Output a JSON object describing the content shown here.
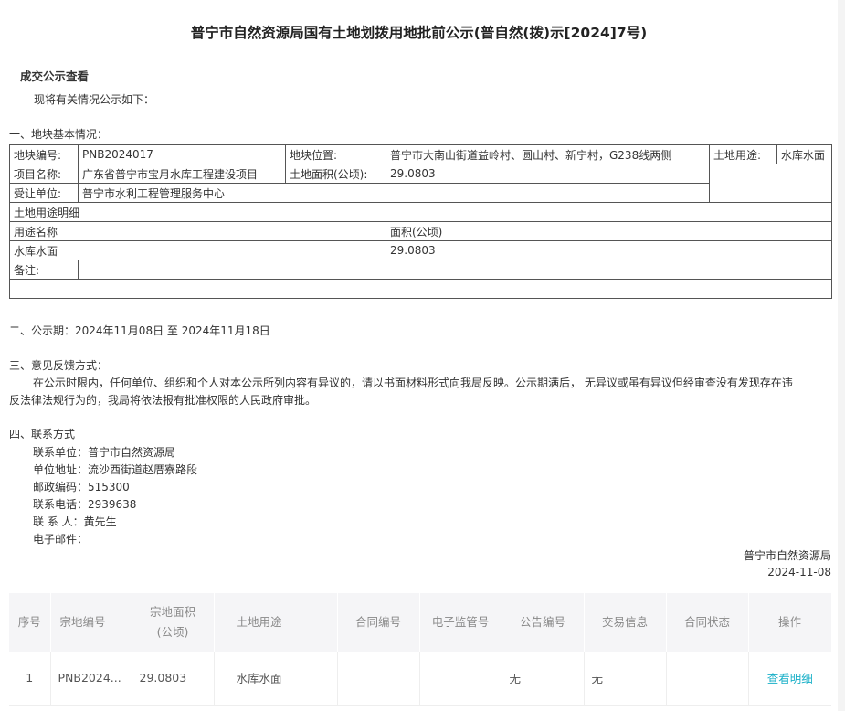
{
  "title": "普宁市自然资源局国有土地划拨用地批前公示(普自然(拨)示[2024]7号)",
  "section_heading": "成交公示查看",
  "intro": "现将有关情况公示如下：",
  "section1_title": "一、地块基本情况：",
  "table": {
    "plot_no_label": "地块编号:",
    "plot_no": "PNB2024017",
    "location_label": "地块位置:",
    "location": "普宁市大南山街道益岭村、圆山村、新宁村，G238线两侧",
    "usage_label": "土地用途:",
    "usage": "水库水面",
    "project_label": "项目名称:",
    "project": "广东省普宁市宝月水库工程建设项目",
    "area_label": "土地面积(公顷):",
    "area": "29.0803",
    "grantee_label": "受让单位:",
    "grantee": "普宁市水利工程管理服务中心",
    "usage_detail_label": "土地用途明细",
    "usage_name_header": "用途名称",
    "area_header": "面积(公顷)",
    "usage_row_name": "水库水面",
    "usage_row_area": "29.0803",
    "remark_label": "备注:",
    "remark": ""
  },
  "section2": "二、公示期：2024年11月08日 至 2024年11月18日",
  "section3_title": "三、意见反馈方式：",
  "section3_line1": "在公示时限内，任何单位、组织和个人对本公示所列内容有异议的，请以书面材料形式向我局反映。公示期满后， 无异议或虽有异议但经审查没有发现存在违",
  "section3_line2": "反法律法规行为的，我局将依法报有批准权限的人民政府审批。",
  "section4_title": "四、联系方式",
  "contact": {
    "unit": "联系单位：普宁市自然资源局",
    "address": "单位地址：流沙西街道赵厝寮路段",
    "postcode": "邮政编码：515300",
    "phone": "联系电话：2939638",
    "person": "联 系 人：黄先生",
    "email": "电子邮件："
  },
  "signature_org": "普宁市自然资源局",
  "signature_date": "2024-11-08",
  "list": {
    "headers": {
      "no": "序号",
      "plot_no": "宗地编号",
      "area_line1": "宗地面积",
      "area_line2": "(公顷)",
      "usage": "土地用途",
      "contract_no": "合同编号",
      "supervision_no": "电子监管号",
      "notice_no": "公告编号",
      "trade_info": "交易信息",
      "contract_status": "合同状态",
      "action": "操作"
    },
    "row": {
      "no": "1",
      "plot_no": "PNB2024...",
      "area": "29.0803",
      "usage": "水库水面",
      "contract_no": "",
      "supervision_no": "",
      "notice_no": "无",
      "trade_info": "无",
      "contract_status": "",
      "action": "查看明细"
    }
  },
  "colors": {
    "link": "#1ab0c8",
    "header_bg": "#f5f5f7"
  }
}
